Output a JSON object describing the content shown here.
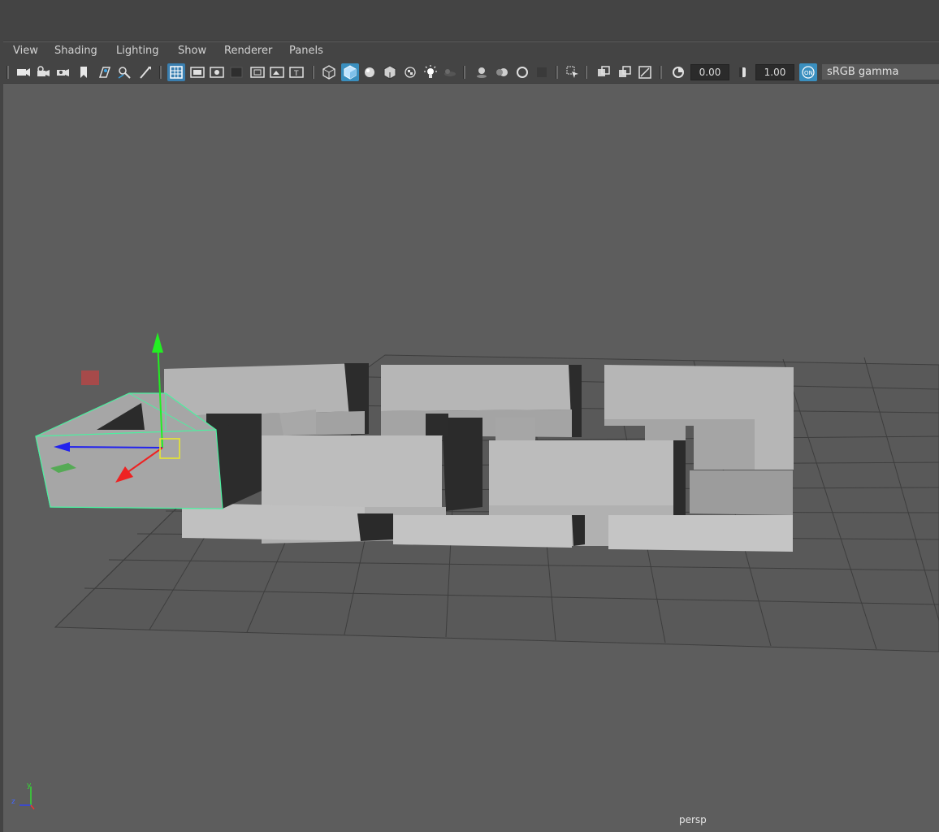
{
  "menubar": {
    "items": [
      "View",
      "Shading",
      "Lighting",
      "Show",
      "Renderer",
      "Panels"
    ]
  },
  "toolbar": {
    "exposure_value": "0.00",
    "gamma_value": "1.00",
    "color_space": "sRGB gamma",
    "icons": [
      "camera-icon",
      "camera-lock-icon",
      "camera-attributes-icon",
      "bookmark-icon",
      "image-plane-icon",
      "grease-pencil-icon",
      "2d-pan-zoom-icon",
      "grid-icon",
      "film-gate-icon",
      "resolution-gate-icon",
      "gate-mask-icon",
      "field-chart-icon",
      "safe-action-icon",
      "safe-title-icon",
      "wireframe-icon",
      "smooth-shade-icon",
      "default-material-icon",
      "wireframe-on-shaded-icon",
      "textured-icon",
      "use-all-lights-icon",
      "shadows-icon",
      "screen-space-ao-icon",
      "motion-blur-icon",
      "anti-aliasing-icon",
      "depth-of-field-icon",
      "isolate-select-icon",
      "xray-icon",
      "xray-active-components-icon",
      "xray-joints-icon",
      "exposure-icon",
      "gamma-icon",
      "color-management-icon"
    ]
  },
  "viewport": {
    "camera_name": "persp",
    "axis_labels": {
      "y": "y",
      "z": "z"
    }
  },
  "colors": {
    "panel": "#444444",
    "viewport_bg": "#5d5d5d",
    "grid": "#3c3c3c",
    "selection": "#4cf0a0",
    "object": "#a8a8a8",
    "active_icon": "#3a8fbf"
  }
}
